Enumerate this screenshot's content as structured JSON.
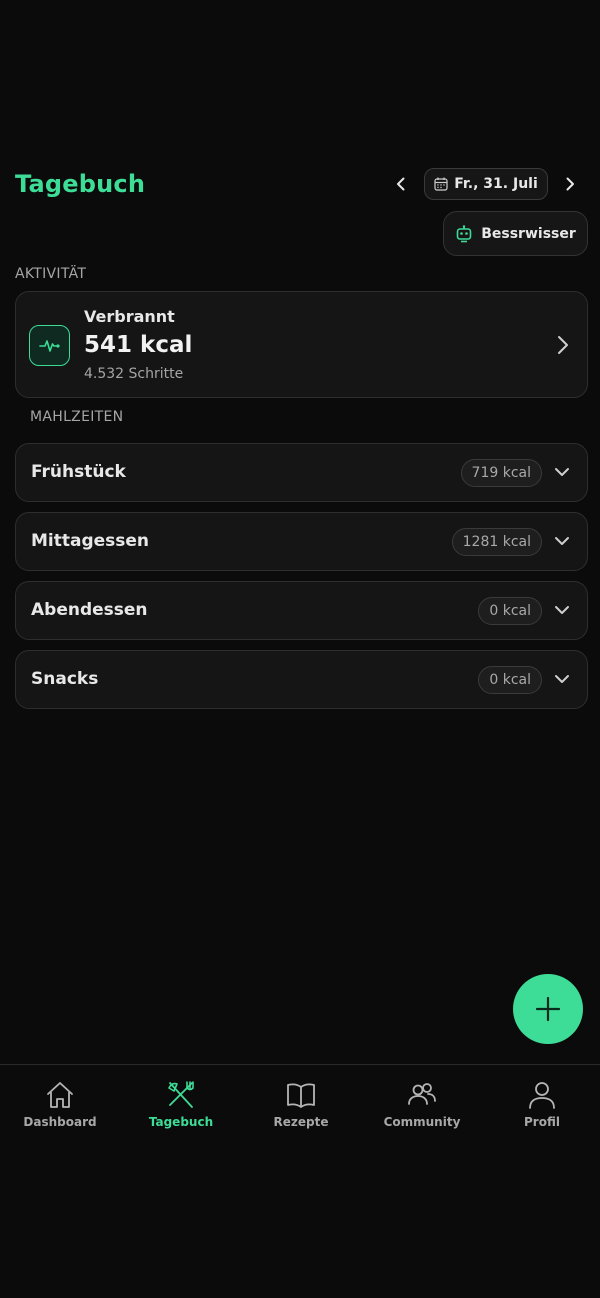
{
  "header": {
    "title": "Tagebuch",
    "date": "Fr., 31. Juli",
    "prev_icon": "chevron-left-icon",
    "next_icon": "chevron-right-icon",
    "calendar_icon": "calendar-icon"
  },
  "advisor": {
    "label": "Bessrwisser",
    "icon": "robot-icon"
  },
  "activity": {
    "section_label": "AKTIVITÄT",
    "title": "Verbrannt",
    "value": "541 kcal",
    "sub": "4.532 Schritte",
    "icon": "heartbeat-icon"
  },
  "meals": {
    "section_label": "MAHLZEITEN",
    "items": [
      {
        "name": "Frühstück",
        "kcal": "719 kcal"
      },
      {
        "name": "Mittagessen",
        "kcal": "1281 kcal"
      },
      {
        "name": "Abendessen",
        "kcal": "0 kcal"
      },
      {
        "name": "Snacks",
        "kcal": "0 kcal"
      }
    ]
  },
  "fab": {
    "icon": "plus-icon"
  },
  "bottom_nav": {
    "items": [
      {
        "label": "Dashboard",
        "icon": "home-icon",
        "active": false
      },
      {
        "label": "Tagebuch",
        "icon": "fork-knife-icon",
        "active": true
      },
      {
        "label": "Rezepte",
        "icon": "book-icon",
        "active": false
      },
      {
        "label": "Community",
        "icon": "users-icon",
        "active": false
      },
      {
        "label": "Profil",
        "icon": "user-icon",
        "active": false
      }
    ]
  },
  "colors": {
    "accent": "#3ddc97",
    "background": "#0b0b0b",
    "card": "#151515",
    "muted": "#a5a5a5"
  }
}
